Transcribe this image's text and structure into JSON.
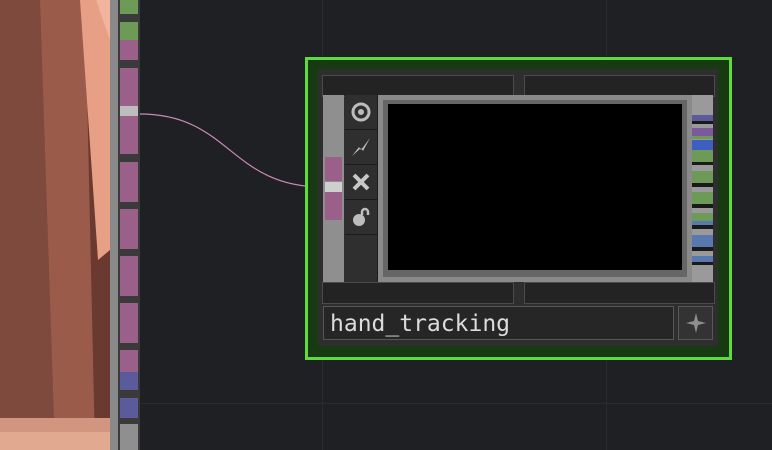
{
  "node": {
    "name": "hand_tracking",
    "selected": true,
    "outline_color": "#5fdc3c",
    "viewer_content": "black",
    "flags": [
      {
        "icon": "viewer-target-icon"
      },
      {
        "icon": "bypass-lightning-icon"
      },
      {
        "icon": "close-x-icon"
      },
      {
        "icon": "lock-icon"
      }
    ],
    "star_icon": "sparkle-icon"
  },
  "wire": {
    "color": "#c98bb5"
  },
  "colors": {
    "background": "#1f2024",
    "port_pink": "#9a6089",
    "port_green": "#6e9a57",
    "port_blue": "#5a78b0"
  }
}
